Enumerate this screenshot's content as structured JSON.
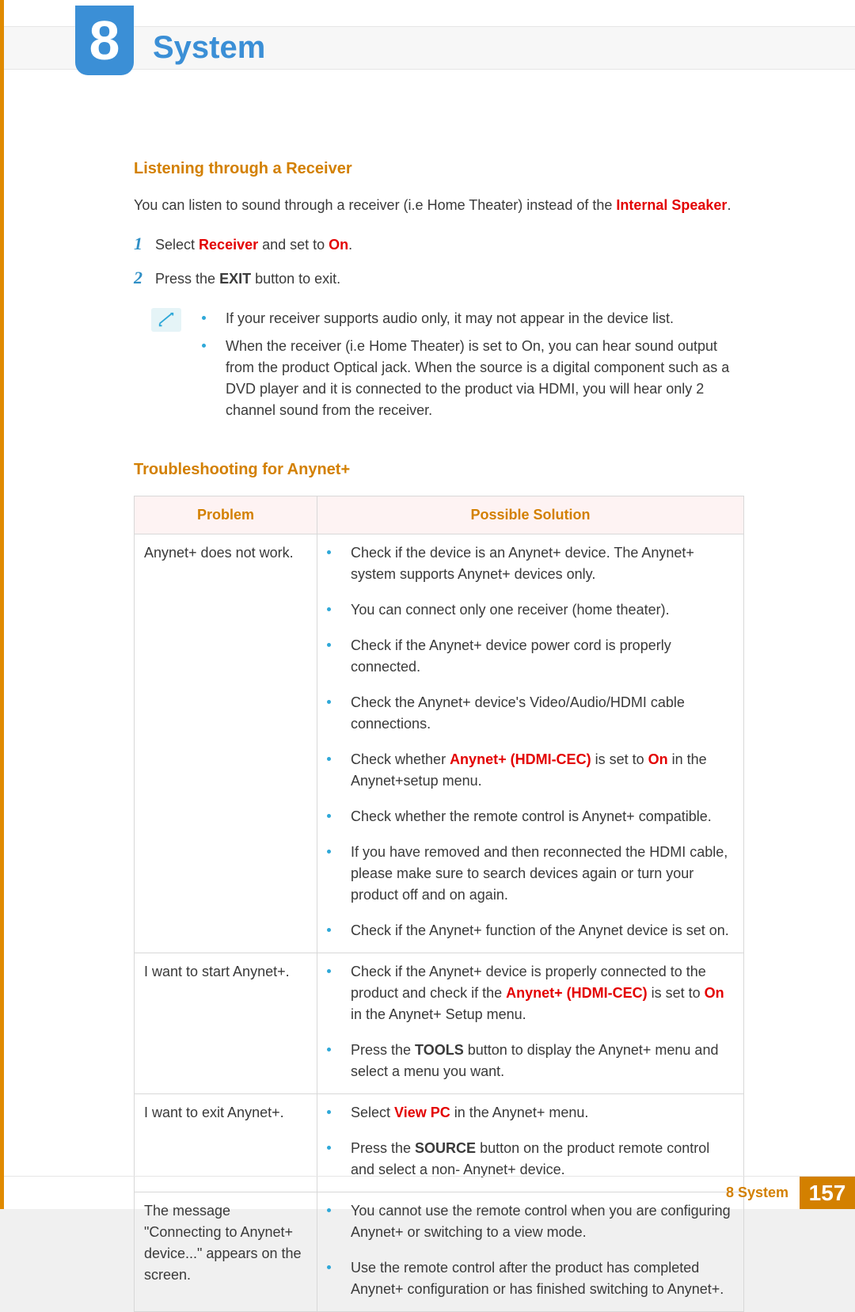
{
  "chapter": {
    "number": "8",
    "title": "System"
  },
  "section1": {
    "heading": "Listening through a Receiver",
    "intro_pre": "You can listen to sound through a receiver (i.e Home Theater) instead of the ",
    "intro_red": "Internal Speaker",
    "intro_post": ".",
    "step1_pre": "Select ",
    "step1_red1": "Receiver",
    "step1_mid": " and set to ",
    "step1_red2": "On",
    "step1_post": ".",
    "step2_pre": "Press the ",
    "step2_bold": "EXIT",
    "step2_post": " button to exit.",
    "notes": [
      "If your receiver supports audio only, it may not appear in the device list.",
      "When the receiver (i.e Home Theater) is set to On, you can hear sound output from the product Optical jack. When the source is a digital component such as a DVD player and it is connected to the product via HDMI, you will hear only 2 channel sound from the receiver."
    ]
  },
  "section2": {
    "heading": "Troubleshooting for Anynet+",
    "th_problem": "Problem",
    "th_solution": "Possible Solution",
    "rows": {
      "r1": {
        "problem": "Anynet+ does not work.",
        "s1": "Check if the device is an Anynet+ device. The Anynet+ system supports Anynet+ devices only.",
        "s2": "You can connect only one receiver (home theater).",
        "s3": "Check if the Anynet+ device power cord is properly connected.",
        "s4": "Check the Anynet+ device's Video/Audio/HDMI cable connections.",
        "s5_pre": "Check whether ",
        "s5_red1": "Anynet+ (HDMI-CEC)",
        "s5_mid": " is set to ",
        "s5_red2": "On",
        "s5_post": " in the Anynet+setup menu.",
        "s6": "Check whether the remote control is Anynet+ compatible.",
        "s7": "If you have removed and then reconnected the HDMI cable, please make sure to search devices again or turn your product off and on again.",
        "s8": "Check if the Anynet+ function of the Anynet device is set on."
      },
      "r2": {
        "problem": "I want to start Anynet+.",
        "s1_pre": "Check if the Anynet+ device is properly connected to the product and check if the ",
        "s1_red1": "Anynet+ (HDMI-CEC)",
        "s1_mid": " is set to ",
        "s1_red2": "On",
        "s1_post": " in the Anynet+ Setup menu.",
        "s2_pre": "Press the ",
        "s2_bold": "TOOLS",
        "s2_post": " button to display the Anynet+ menu and select a menu you want."
      },
      "r3": {
        "problem": "I want to exit Anynet+.",
        "s1_pre": "Select ",
        "s1_red": "View PC",
        "s1_post": " in the Anynet+ menu.",
        "s2_pre": "Press the ",
        "s2_bold": "SOURCE",
        "s2_post": " button on the product remote control and select a non- Anynet+ device."
      },
      "r4": {
        "problem": "The message \"Connecting to Anynet+ device...\" appears on the screen.",
        "s1": "You cannot use the remote control when you are configuring Anynet+ or switching to a view mode.",
        "s2": "Use the remote control after the product has completed Anynet+ configuration or has finished switching to Anynet+."
      }
    }
  },
  "footer": {
    "label": "8 System",
    "page": "157"
  }
}
